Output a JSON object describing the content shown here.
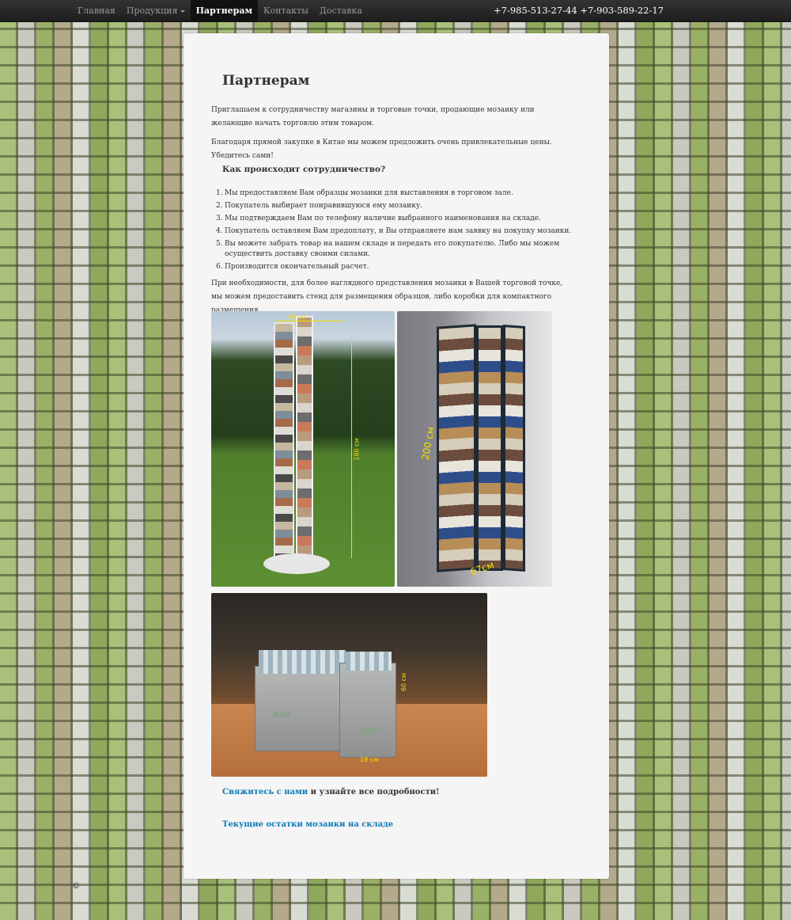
{
  "nav": {
    "items": [
      {
        "label": "Главная",
        "active": false
      },
      {
        "label": "Продукция",
        "active": false,
        "dropdown": true
      },
      {
        "label": "Партнерам",
        "active": true
      },
      {
        "label": "Контакты",
        "active": false
      },
      {
        "label": "Доставка",
        "active": false
      }
    ],
    "phones": "+7-985-513-27-44 +7-903-589-22-17"
  },
  "page": {
    "title": "Партнерам",
    "intro1": "Приглашаем к сотрудничеству магазины и торговые точки, продающие мозаику или желающие начать торговлю этим товаром.",
    "intro2": "Благодаря прямой закупке в Китае мы можем предложить очень привлекательные цены. Убедитесь сами!",
    "how_title": "Как происходит сотрудничество?",
    "steps": [
      "Мы предоставляем Вам образцы мозаики для выставления в торговом зале.",
      "Покупатель выбирает понравившуюся ему мозаику.",
      "Мы подтверждаем Вам по телефону наличие выбранного наименования на складе.",
      "Покупатель оставляем Вам предоплату, и Вы отправляете нам заявку на покупку мозаики.",
      "Вы можете забрать товар на нашем складе и передать его покупателю. Либо мы можем осуществить доставку своими силами.",
      "Производится окончательный расчет."
    ],
    "stands_text": "При необходимости, для более наглядного представления мозаики в Вашей торговой точке, мы можем предоставить стенд для размещения образцов, либо коробки для компактного размещения.",
    "photo_labels": {
      "stand_width": "40 см",
      "stand_height": "160 см",
      "rack_height": "200 см",
      "rack_width": "67см",
      "box_height": "60 см",
      "box_width": "18 см",
      "box_logo": "DAO"
    },
    "cta_link": "Свяжитесь с нами",
    "cta_rest": " и узнайте все подробности!",
    "stock_link": "Текущие остатки мозаики на складе"
  },
  "footer": {
    "copyright": "©"
  }
}
